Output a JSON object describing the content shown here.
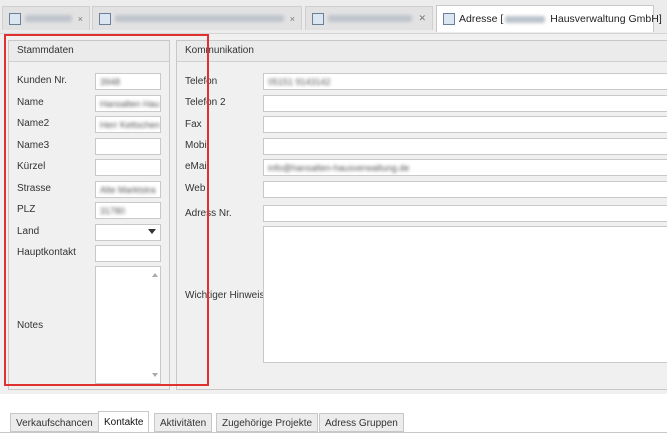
{
  "doc_tabs": {
    "active_prefix": "Adresse [",
    "active_suffix": "Hausverwaltung GmbH]",
    "close_glyph": "✕",
    "inactive_close_glyph": "×"
  },
  "stammdaten": {
    "title": "Stammdaten",
    "fields": [
      {
        "label": "Kunden Nr.",
        "value": "3948"
      },
      {
        "label": "Name",
        "value": "Hansalten Hau"
      },
      {
        "label": "Name2",
        "value": "Herr Kettschen"
      },
      {
        "label": "Name3",
        "value": ""
      },
      {
        "label": "Kürzel",
        "value": ""
      },
      {
        "label": "Strasse",
        "value": "Alte Marktstra"
      },
      {
        "label": "PLZ",
        "value": "31780"
      },
      {
        "label": "Land",
        "value": ""
      },
      {
        "label": "Hauptkontakt",
        "value": ""
      }
    ],
    "notes_label": "Notes"
  },
  "kommunikation": {
    "title": "Kommunikation",
    "fields": [
      {
        "label": "Telefon",
        "value": "05151 9143142"
      },
      {
        "label": "Telefon 2",
        "value": ""
      },
      {
        "label": "Fax",
        "value": ""
      },
      {
        "label": "Mobil",
        "value": ""
      },
      {
        "label": "eMail",
        "value": "info@hansalten-hausverwaltung.de"
      },
      {
        "label": "Web",
        "value": ""
      },
      {
        "label": "Adress Nr.",
        "value": ""
      }
    ],
    "hinweis_label": "Wichtiger Hinweis"
  },
  "bottom_tabs": [
    "Verkaufschancen",
    "Kontakte",
    "Aktivitäten",
    "Zugehörige Projekte",
    "Adress Gruppen"
  ],
  "active_bottom_tab": "Kontakte",
  "colors": {
    "highlight": "#e03030",
    "panel": "#f0f0f0"
  }
}
